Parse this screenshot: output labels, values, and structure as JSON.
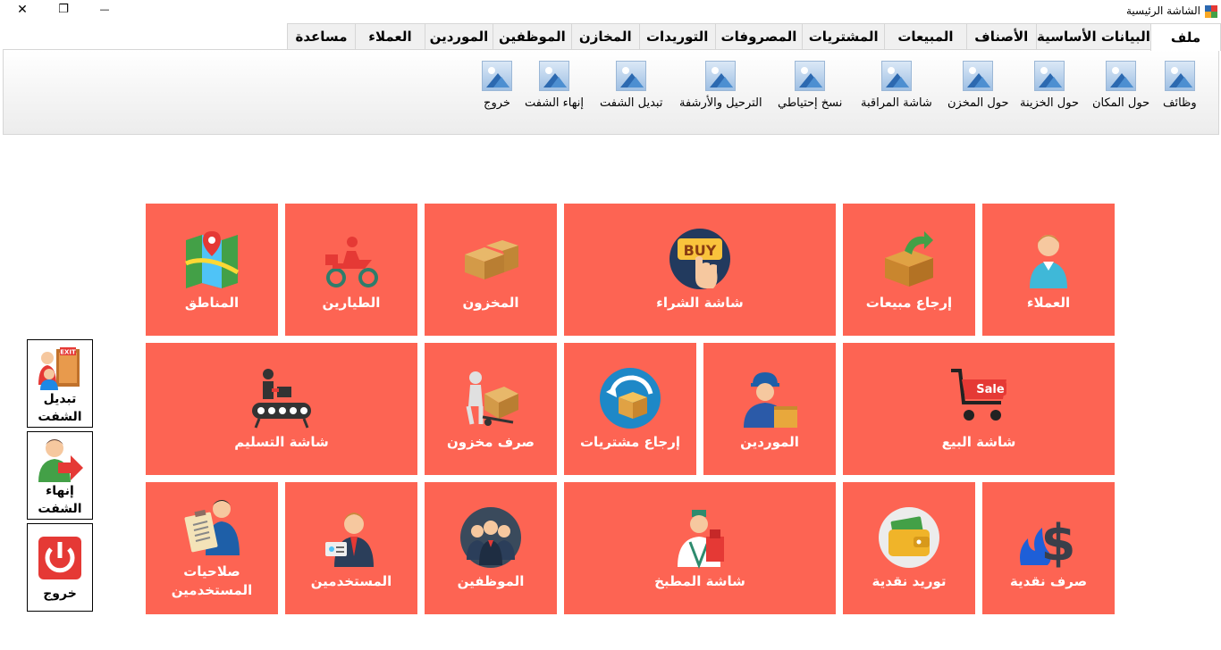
{
  "window": {
    "title": "الشاشة الرئيسية",
    "close_glyph": "✕",
    "restore_glyph": "❐",
    "minimize_glyph": "—"
  },
  "menu": [
    "ملف",
    "البيانات الأساسية",
    "الأصناف",
    "المبيعات",
    "المشتريات",
    "المصروفات",
    "التوريدات",
    "المخازن",
    "الموظفين",
    "الموردين",
    "العملاء",
    "مساعدة"
  ],
  "toolbar": [
    "وظائف",
    "حول المكان",
    "حول الخزينة",
    "حول المخزن",
    "شاشة المراقبة",
    "نسخ إحتياطي",
    "الترحيل والأرشفة",
    "تبديل الشفت",
    "إنهاء الشفت",
    "خروج"
  ],
  "tiles": {
    "customers": "العملاء",
    "sales_return": "إرجاع مبيعات",
    "purchase_screen": "شاشة الشراء",
    "stock": "المخزون",
    "pilots": "الطيارين",
    "areas": "المناطق",
    "sale_screen": "شاشة البيع",
    "suppliers": "الموردين",
    "purchase_return": "إرجاع مشتريات",
    "stock_issue": "صرف مخزون",
    "delivery_screen": "شاشة التسليم",
    "cash_out": "صرف نقدية",
    "cash_in": "توريد نقدية",
    "kitchen_screen": "شاشة المطبخ",
    "employees": "الموظفين",
    "users": "المستخدمين",
    "user_permissions_line1": "صلاحيات",
    "user_permissions_line2": "المستخدمين",
    "buy_badge": "BUY",
    "sale_badge": "Sale"
  },
  "side": {
    "switch_line1": "تبديل",
    "switch_line2": "الشفت",
    "end_line1": "إنهاء",
    "end_line2": "الشفت",
    "exit": "خروج",
    "exit_sign": "EXIT"
  },
  "colors": {
    "tile": "#fd6453",
    "tile_text": "#ffffff",
    "toolbar_icon": "#2c69b0"
  }
}
